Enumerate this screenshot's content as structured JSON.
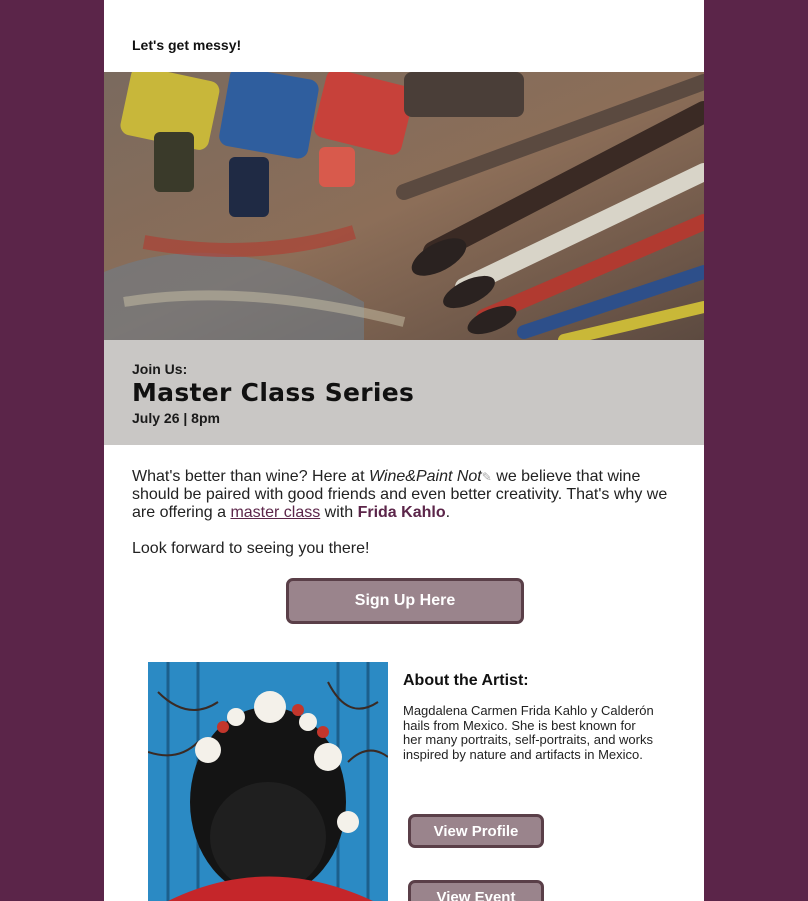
{
  "preheader": "Let's get messy!",
  "hero": {
    "alt": "paint-tubes-and-brushes-photo"
  },
  "banner": {
    "eyebrow": "Join Us:",
    "title": "Master Class Series",
    "date": "July 26 | 8pm"
  },
  "intro": {
    "p1_a": "What's better than wine? Here at ",
    "brand": "Wine&Paint Not",
    "p1_b": " we believe that wine should be paired with good friends and even better creativity. That's why we are offering a ",
    "link": "master class",
    "p1_c": " with ",
    "artist": "Frida Kahlo",
    "p1_d": ".",
    "p2": "Look forward to seeing you there!"
  },
  "cta_label": "Sign Up Here",
  "about": {
    "title": "About the Artist:",
    "text": "Magdalena Carmen Frida Kahlo y Calderón hails from Mexico. She is best known for her many portraits, self-portraits, and works inspired by nature and artifacts in Mexico.",
    "view_profile": "View Profile",
    "view_event": "View Event"
  },
  "colors": {
    "page_bg": "#5b2549",
    "banner_bg": "#c9c7c5",
    "button_bg": "#9a848c",
    "button_border": "#5a3f48",
    "link": "#5b2549"
  }
}
